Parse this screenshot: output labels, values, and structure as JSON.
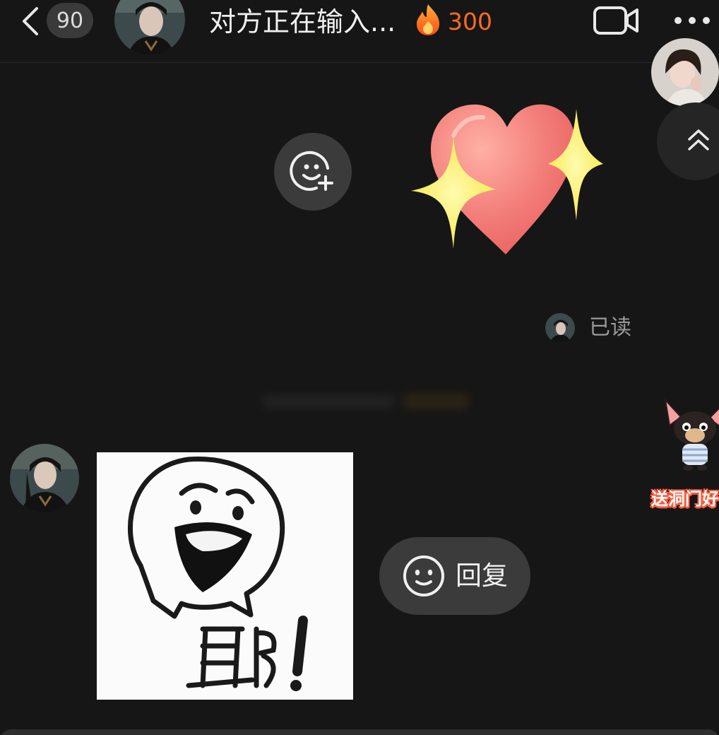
{
  "header": {
    "unread_count": "90",
    "title": "对方正在输入...",
    "streak": "300"
  },
  "read_receipt": {
    "status": "已读"
  },
  "reply_button": {
    "label": "回复"
  },
  "gift": {
    "label": "送洞门好"
  },
  "meme": {
    "caption": "耶!"
  },
  "icons": {
    "back": "chevron-left-icon",
    "flame": "flame-icon",
    "video": "video-camera-icon",
    "more": "more-dots-icon",
    "scroll_top": "double-chevron-up-icon",
    "add_reaction": "smiley-plus-icon",
    "reply": "smiley-icon"
  },
  "colors": {
    "background": "#161616",
    "streak": "#ff6a1f",
    "bubble": "#3b3b3b",
    "read_text": "#9a9a9a"
  }
}
